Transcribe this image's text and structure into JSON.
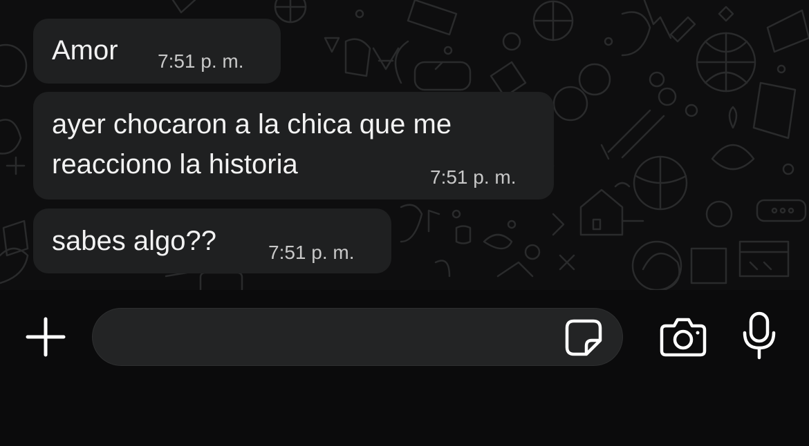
{
  "messages": [
    {
      "text": "Amor",
      "time": "7:51 p. m."
    },
    {
      "text": "ayer chocaron a la chica que me\nreacciono la historia",
      "time": "7:51 p. m."
    },
    {
      "text": "sabes algo??",
      "time": "7:51 p. m."
    }
  ],
  "composer": {
    "placeholder": "",
    "value": ""
  },
  "icons": {
    "attach": "plus-icon",
    "sticker": "sticker-icon",
    "camera": "camera-icon",
    "mic": "microphone-icon"
  },
  "colors": {
    "background": "#0b0b0c",
    "bubble": "#1f2021",
    "input_field": "#232425",
    "text": "#f2f2f2",
    "timestamp": "#c8c8c8"
  }
}
